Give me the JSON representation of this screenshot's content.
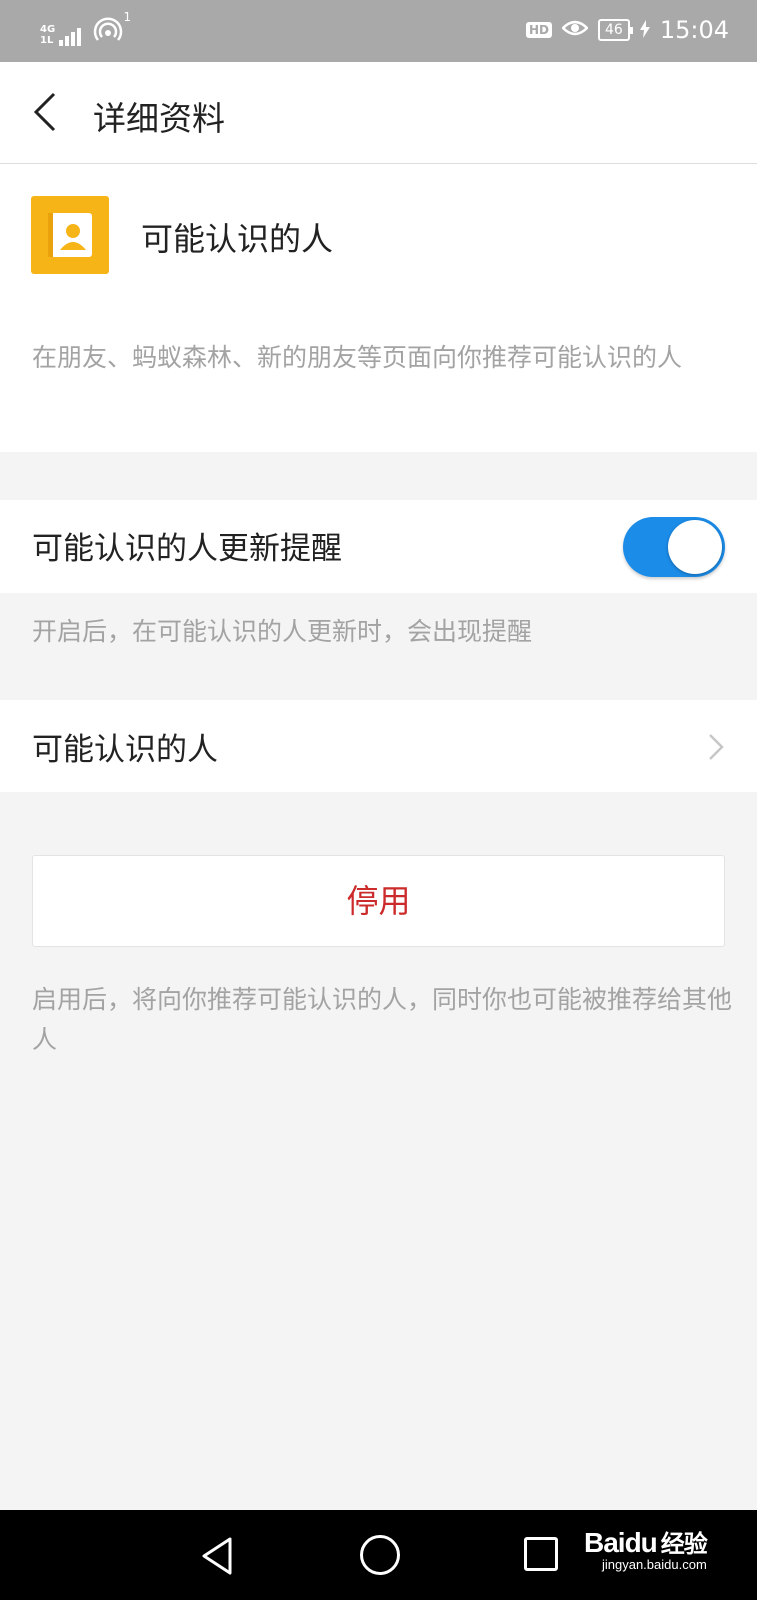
{
  "status_bar": {
    "network_label": "4G",
    "network_sub": "1L",
    "hotspot_count": "1",
    "hd_label": "HD",
    "battery": "46",
    "time": "15:04"
  },
  "header": {
    "title": "详细资料"
  },
  "profile": {
    "title": "可能认识的人",
    "description": "在朋友、蚂蚁森林、新的朋友等页面向你推荐可能认识的人"
  },
  "update_reminder": {
    "label": "可能认识的人更新提醒",
    "enabled": true,
    "hint": "开启后，在可能认识的人更新时，会出现提醒"
  },
  "people_link": {
    "label": "可能认识的人"
  },
  "disable_button": {
    "label": "停用",
    "color": "#cc2b2b",
    "hint": "启用后，将向你推荐可能认识的人，同时你也可能被推荐给其他人"
  },
  "watermark": {
    "logo": "Baidu",
    "suffix": "经验",
    "url": "jingyan.baidu.com"
  },
  "colors": {
    "accent": "#1b8ce8",
    "icon_bg": "#f6b417"
  }
}
